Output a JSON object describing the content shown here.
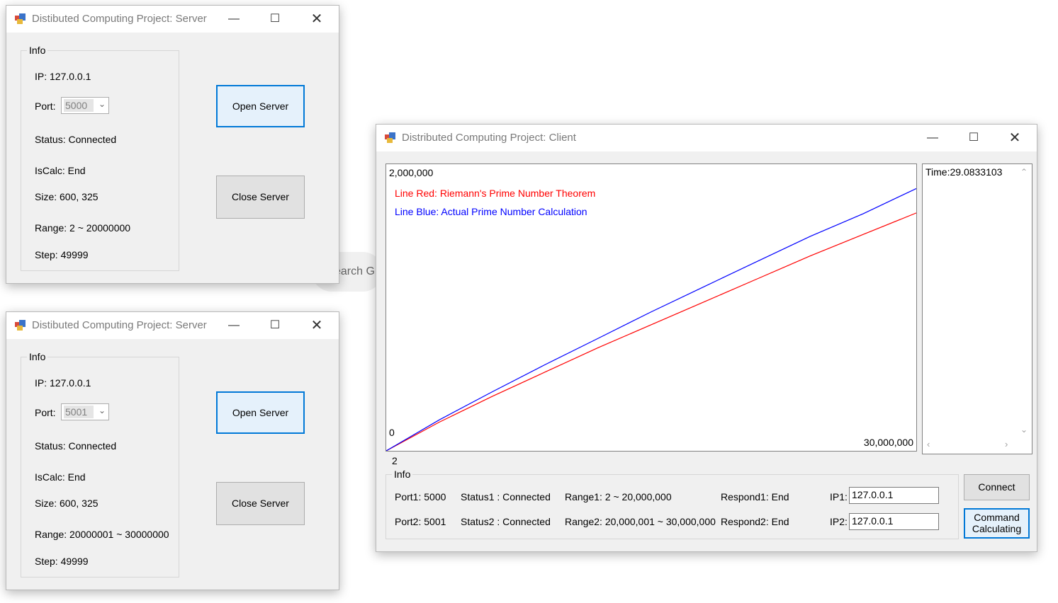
{
  "background": {
    "search_text": "earch G"
  },
  "servers": [
    {
      "title": "Distibuted Computing Project: Server",
      "group_label": "Info",
      "ip": "IP: 127.0.0.1",
      "port_label": "Port:",
      "port_value": "5000",
      "status": "Status: Connected",
      "iscalc": "IsCalc: End",
      "size": "Size: 600, 325",
      "range": "Range: 2 ~ 20000000",
      "step": "Step: 49999",
      "open_label": "Open Server",
      "close_label": "Close Server"
    },
    {
      "title": "Distibuted Computing Project: Server",
      "group_label": "Info",
      "ip": "IP: 127.0.0.1",
      "port_label": "Port:",
      "port_value": "5001",
      "status": "Status: Connected",
      "iscalc": "IsCalc: End",
      "size": "Size: 600, 325",
      "range": "Range: 20000001 ~ 30000000",
      "step": "Step: 49999",
      "open_label": "Open Server",
      "close_label": "Close Server"
    }
  ],
  "client": {
    "title": "Distributed Computing Project: Client",
    "chart": {
      "y_max_label": "2,000,000",
      "y_min_label": "0",
      "x_max_label": "30,000,000",
      "x_min_label": "2",
      "legend_red": "Line Red: Riemann's Prime Number Theorem",
      "legend_blue": "Line Blue: Actual Prime Number Calculation"
    },
    "time_text": "Time:29.0833103",
    "info_label": "Info",
    "port1": "Port1: 5000",
    "port2": "Port2: 5001",
    "status1": "Status1 : Connected",
    "status2": "Status2 : Connected",
    "range1": "Range1: 2 ~ 20,000,000",
    "range2": "Range2: 20,000,001 ~ 30,000,000",
    "respond1": "Respond1: End",
    "respond2": "Respond2: End",
    "ip1_label": "IP1:",
    "ip1_value": "127.0.0.1",
    "ip2_label": "IP2:",
    "ip2_value": "127.0.0.1",
    "connect_label": "Connect",
    "command_line1": "Command",
    "command_line2": "Calculating"
  },
  "chart_data": {
    "type": "line",
    "xlim": [
      2,
      30000000
    ],
    "ylim": [
      0,
      2000000
    ],
    "series": [
      {
        "name": "Line Red: Riemann's Prime Number Theorem",
        "color": "#ff0000",
        "x": [
          2,
          3000000,
          6000000,
          9000000,
          12000000,
          15000000,
          18000000,
          21000000,
          24000000,
          27000000,
          30000000
        ],
        "y": [
          0,
          200000,
          380000,
          550000,
          720000,
          880000,
          1040000,
          1200000,
          1360000,
          1510000,
          1660000
        ]
      },
      {
        "name": "Line Blue: Actual Prime Number Calculation",
        "color": "#0000ff",
        "x": [
          2,
          3000000,
          6000000,
          9000000,
          12000000,
          15000000,
          18000000,
          21000000,
          24000000,
          27000000,
          30000000
        ],
        "y": [
          0,
          216000,
          412000,
          602000,
          785000,
          970000,
          1146000,
          1322000,
          1497000,
          1655000,
          1830000
        ]
      }
    ]
  }
}
